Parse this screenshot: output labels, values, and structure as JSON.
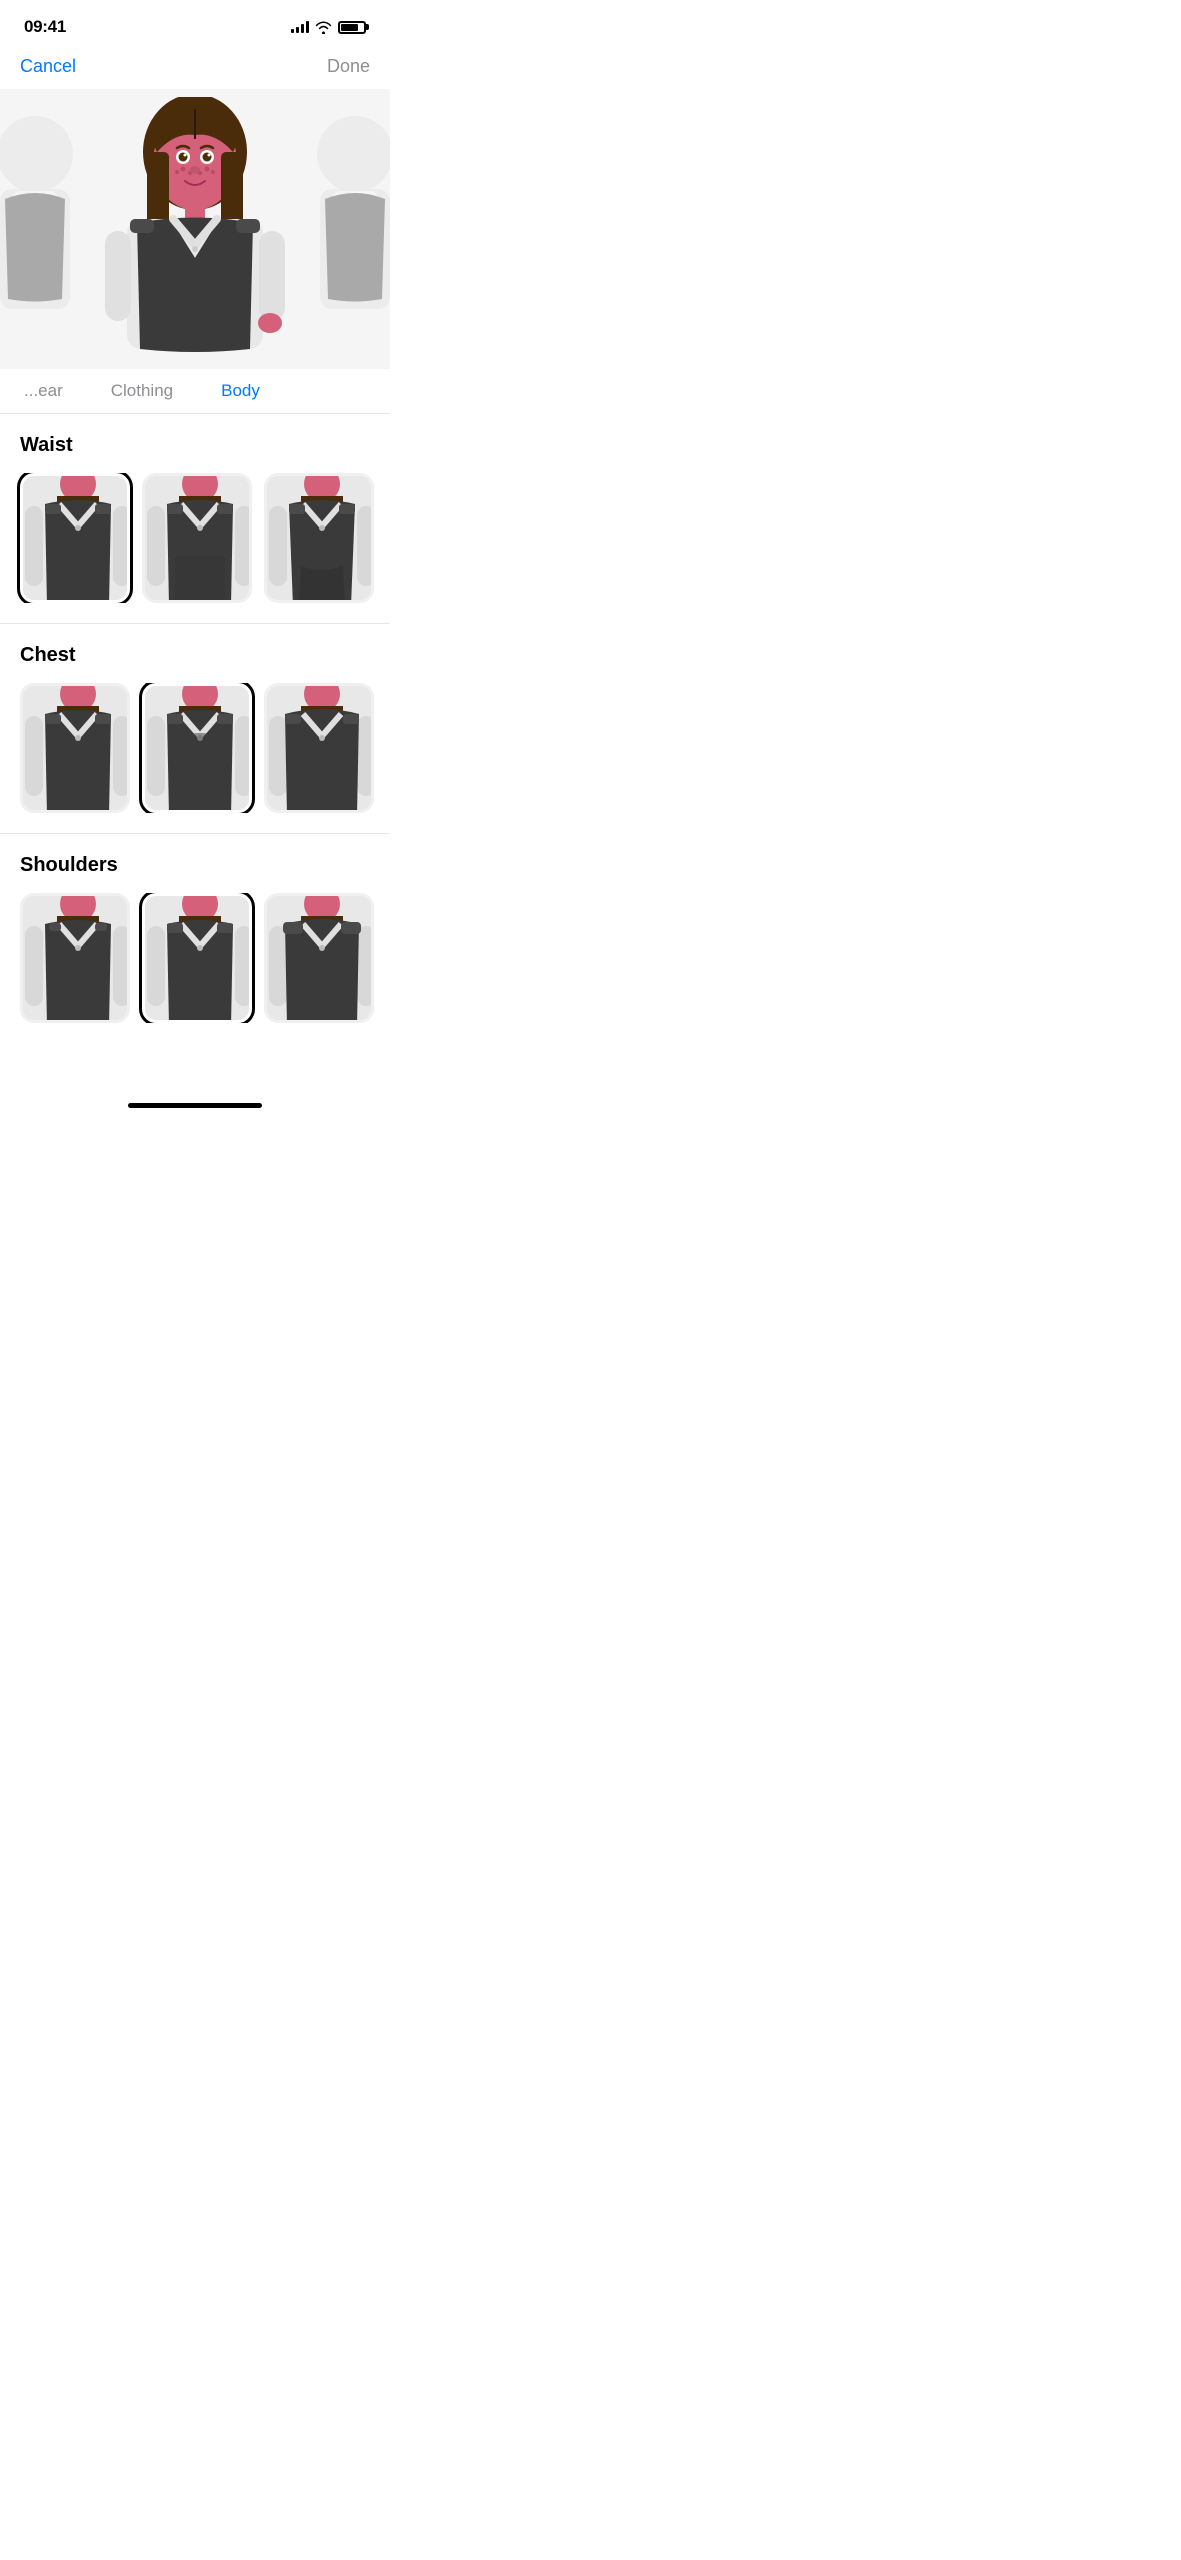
{
  "statusBar": {
    "time": "09:41",
    "signal": [
      3,
      5,
      7,
      9,
      11
    ],
    "wifi": true,
    "battery": 75
  },
  "nav": {
    "cancel": "Cancel",
    "done": "Done"
  },
  "tabs": [
    {
      "id": "headwear",
      "label": "...ear",
      "active": false
    },
    {
      "id": "clothing",
      "label": "Clothing",
      "active": false
    },
    {
      "id": "body",
      "label": "Body",
      "active": true
    }
  ],
  "sections": [
    {
      "id": "waist",
      "title": "Waist",
      "options": [
        {
          "id": "waist-1",
          "selected": true
        },
        {
          "id": "waist-2",
          "selected": false
        },
        {
          "id": "waist-3",
          "selected": false
        }
      ]
    },
    {
      "id": "chest",
      "title": "Chest",
      "options": [
        {
          "id": "chest-1",
          "selected": false
        },
        {
          "id": "chest-2",
          "selected": true
        },
        {
          "id": "chest-3",
          "selected": false
        }
      ]
    },
    {
      "id": "shoulders",
      "title": "Shoulders",
      "options": [
        {
          "id": "shoulders-1",
          "selected": false
        },
        {
          "id": "shoulders-2",
          "selected": true
        },
        {
          "id": "shoulders-3",
          "selected": false
        }
      ]
    }
  ]
}
